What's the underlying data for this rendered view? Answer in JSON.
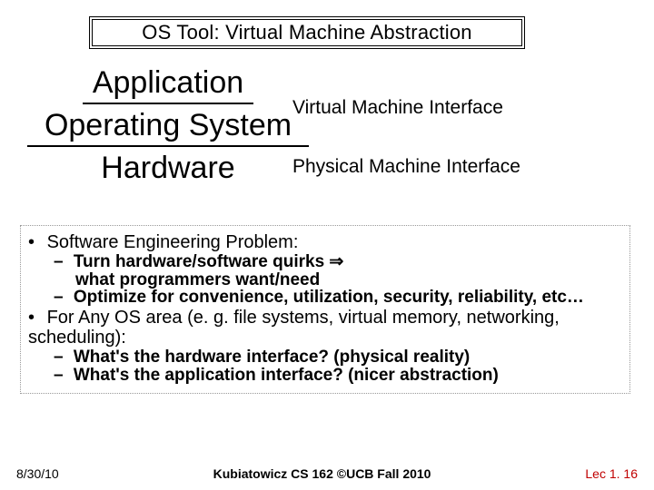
{
  "title": "OS Tool: Virtual Machine Abstraction",
  "stack": {
    "application": "Application",
    "os": "Operating System",
    "hardware": "Hardware"
  },
  "interfaces": {
    "vmi": "Virtual Machine Interface",
    "pmi": "Physical Machine Interface"
  },
  "bullets": {
    "b1": "Software Engineering Problem:",
    "b1a_line1": "Turn hardware/software quirks ",
    "b1a_arrow": "⇒",
    "b1a_line2": "what programmers want/need",
    "b1b": "Optimize for convenience, utilization, security, reliability, etc…",
    "b2": "For Any OS area (e. g. file systems, virtual memory, networking, scheduling):",
    "b2a": "What's the hardware interface? (physical reality)",
    "b2b": "What's the application interface? (nicer abstraction)"
  },
  "footer": {
    "date": "8/30/10",
    "center": "Kubiatowicz CS 162 ©UCB Fall 2010",
    "page": "Lec 1. 16"
  }
}
